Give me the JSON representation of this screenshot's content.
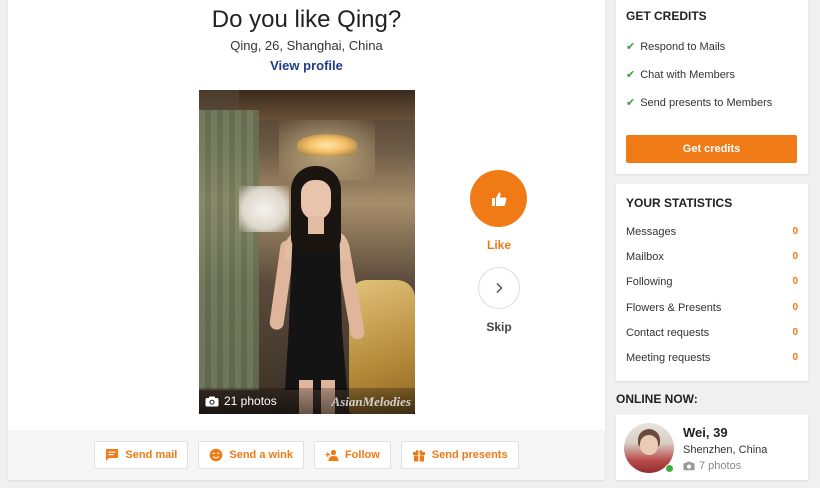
{
  "main": {
    "title": "Do you like Qing?",
    "subtitle": "Qing, 26, Shanghai, China",
    "view_profile": "View profile",
    "photo_count": "21 photos",
    "watermark": "AsianMelodies",
    "like_label": "Like",
    "skip_label": "Skip",
    "actions": {
      "send_mail": "Send mail",
      "send_wink": "Send a wink",
      "follow": "Follow",
      "send_presents": "Send presents"
    }
  },
  "credits": {
    "title": "GET CREDITS",
    "items": [
      "Respond to Mails",
      "Chat with Members",
      "Send presents to Members"
    ],
    "button": "Get credits"
  },
  "stats": {
    "title": "YOUR STATISTICS",
    "rows": [
      {
        "label": "Messages",
        "value": "0"
      },
      {
        "label": "Mailbox",
        "value": "0"
      },
      {
        "label": "Following",
        "value": "0"
      },
      {
        "label": "Flowers & Presents",
        "value": "0"
      },
      {
        "label": "Contact requests",
        "value": "0"
      },
      {
        "label": "Meeting requests",
        "value": "0"
      }
    ]
  },
  "online": {
    "title": "ONLINE NOW:",
    "name": "Wei, 39",
    "location": "Shenzhen, China",
    "photos": "7 photos"
  },
  "colors": {
    "accent": "#f07a16",
    "link": "#1f3c88",
    "check": "#3a9d3a",
    "online": "#3cb043"
  },
  "icons": [
    "camera-icon",
    "thumbs-up-icon",
    "chevron-right-icon",
    "chat-icon",
    "wink-icon",
    "follow-icon",
    "gift-icon",
    "check-icon"
  ]
}
